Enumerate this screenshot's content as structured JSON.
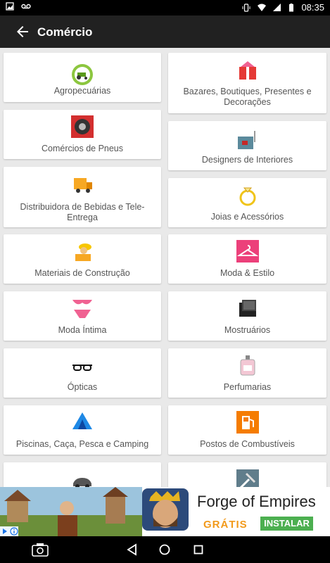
{
  "status_bar": {
    "time": "08:35"
  },
  "app_bar": {
    "title": "Comércio"
  },
  "categories": [
    {
      "label": "Agropecuárias",
      "icon": "tractor-icon"
    },
    {
      "label": "Bazares, Boutiques, Presentes e Decorações",
      "icon": "gift-box-icon"
    },
    {
      "label": "Comércios de Pneus",
      "icon": "tire-icon"
    },
    {
      "label": "Designers de Interiores",
      "icon": "interior-room-icon"
    },
    {
      "label": "Distribuidora de Bebidas e Tele-Entrega",
      "icon": "delivery-icon"
    },
    {
      "label": "Joias e Acessórios",
      "icon": "ring-icon"
    },
    {
      "label": "Materiais de Construção",
      "icon": "construction-worker-icon"
    },
    {
      "label": "Moda & Estilo",
      "icon": "hanger-icon"
    },
    {
      "label": "Moda Íntima",
      "icon": "lingerie-icon"
    },
    {
      "label": "Mostruários",
      "icon": "display-case-icon"
    },
    {
      "label": "Ópticas",
      "icon": "glasses-icon"
    },
    {
      "label": "Perfumarias",
      "icon": "perfume-icon"
    },
    {
      "label": "Piscinas, Caça, Pesca e Camping",
      "icon": "tent-icon"
    },
    {
      "label": "Postos de Combustíveis",
      "icon": "fuel-pump-icon"
    },
    {
      "label": "",
      "icon": "car-icon"
    },
    {
      "label": "",
      "icon": "tools-icon"
    }
  ],
  "ad": {
    "title": "Forge of Empires",
    "free_label": "GRÁTIS",
    "install_label": "INSTALAR"
  },
  "colors": {
    "app_bar": "#212121",
    "status_bar": "#000000",
    "background": "#e9e9e9",
    "install_button": "#4caf50",
    "free_text": "#f29a1b"
  }
}
